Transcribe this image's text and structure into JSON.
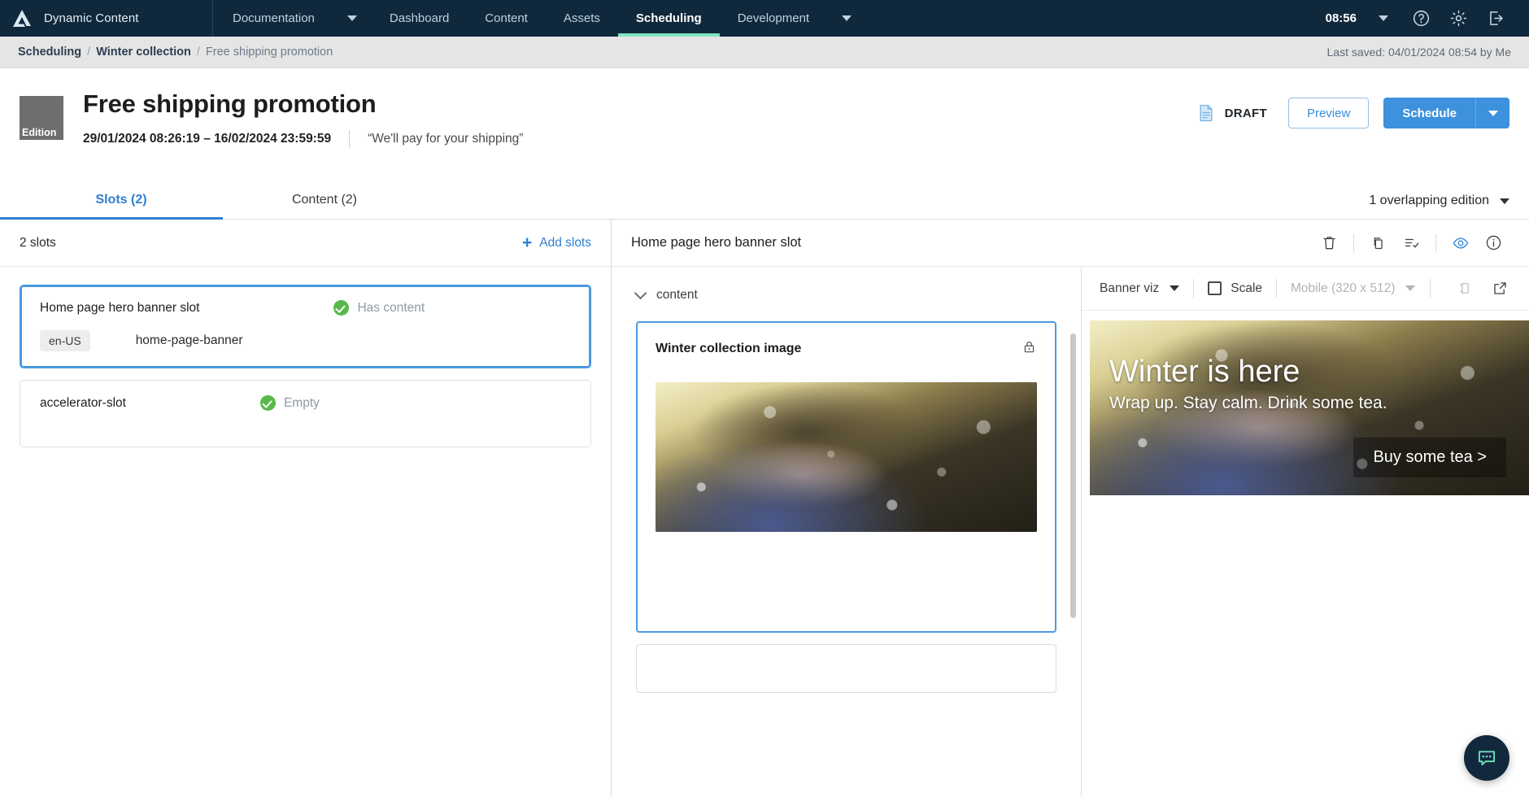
{
  "topnav": {
    "brand": "Dynamic Content",
    "logo_icon": "amplience-logo-icon",
    "items": [
      {
        "label": "Documentation",
        "has_caret": true,
        "active": false
      },
      {
        "label": "Dashboard",
        "has_caret": false,
        "active": false
      },
      {
        "label": "Content",
        "has_caret": false,
        "active": false
      },
      {
        "label": "Assets",
        "has_caret": false,
        "active": false
      },
      {
        "label": "Scheduling",
        "has_caret": false,
        "active": true
      },
      {
        "label": "Development",
        "has_caret": true,
        "active": false
      }
    ],
    "clock": "08:56",
    "clock_caret_icon": "chevron-down-icon",
    "help_icon": "help-circle-icon",
    "settings_icon": "gear-icon",
    "logout_icon": "logout-icon"
  },
  "breadcrumb": {
    "items": [
      "Scheduling",
      "Winter collection",
      "Free shipping promotion"
    ],
    "separator": "/",
    "last_saved": "Last saved: 04/01/2024 08:54 by Me"
  },
  "header": {
    "thumb_label": "Edition",
    "title": "Free shipping promotion",
    "date_range": "29/01/2024 08:26:19  –  16/02/2024 23:59:59",
    "comment": "“We'll pay for your shipping”",
    "status_icon": "draft-document-icon",
    "status": "DRAFT",
    "preview_label": "Preview",
    "schedule_label": "Schedule",
    "schedule_caret_icon": "chevron-down-icon"
  },
  "tabs": {
    "items": [
      {
        "label": "Slots (2)",
        "active": true
      },
      {
        "label": "Content (2)",
        "active": false
      }
    ],
    "overlap_label": "1 overlapping edition",
    "overlap_caret_icon": "chevron-down-icon"
  },
  "slots_panel": {
    "count_label": "2 slots",
    "add_label": "Add slots",
    "add_icon": "plus-icon",
    "slots": [
      {
        "name": "Home page hero banner slot",
        "status": "Has content",
        "status_icon": "check-circle-icon",
        "locale": "en-US",
        "content_key": "home-page-banner",
        "selected": true
      },
      {
        "name": "accelerator-slot",
        "status": "Empty",
        "status_icon": "check-circle-icon",
        "locale": "",
        "content_key": "",
        "selected": false
      }
    ]
  },
  "editor": {
    "title": "Home page hero banner slot",
    "icons": [
      {
        "name": "delete-icon"
      },
      {
        "name": "copy-icon"
      },
      {
        "name": "list-check-icon"
      },
      {
        "name": "visibility-eye-icon"
      },
      {
        "name": "info-icon"
      }
    ],
    "form": {
      "group_label": "content",
      "group_chevron_icon": "chevron-down-icon",
      "field_label": "Winter collection image",
      "lock_icon": "lock-icon",
      "image_alt": "winter-collection-image"
    }
  },
  "preview": {
    "viz_label": "Banner viz",
    "viz_caret_icon": "chevron-down-icon",
    "scale_label": "Scale",
    "scale_checkbox_icon": "checkbox-unchecked-icon",
    "device_label": "Mobile (320 x 512)",
    "device_caret_icon": "chevron-down-icon",
    "refresh_icon": "refresh-device-icon",
    "popout_icon": "open-external-icon",
    "banner": {
      "headline": "Winter is here",
      "subhead": "Wrap up. Stay calm. Drink some tea.",
      "cta": "Buy some tea >"
    }
  },
  "chat": {
    "icon": "chat-bubble-icon"
  },
  "colors": {
    "nav_bg": "#10283c",
    "nav_active_underline": "#7fe3c1",
    "accent_blue": "#3d91dd",
    "link_blue": "#2f7fd0",
    "success_green": "#56b94a",
    "breadcrumb_bg": "#e5e5e5",
    "chat_bg": "#12293d"
  }
}
